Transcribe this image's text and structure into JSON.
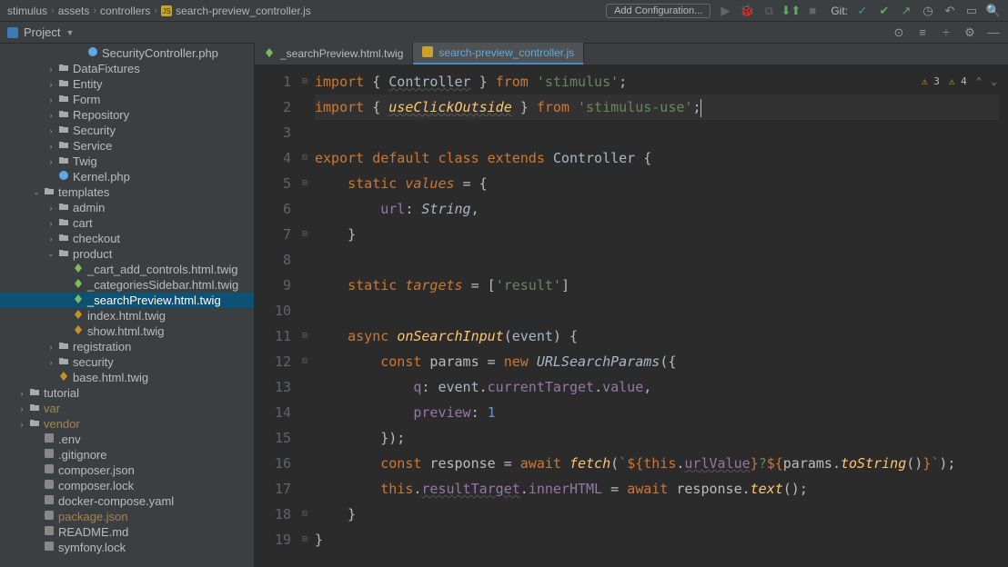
{
  "breadcrumb": [
    "stimulus",
    "assets",
    "controllers",
    "search-preview_controller.js"
  ],
  "toolbar": {
    "add_config": "Add Configuration...",
    "git_label": "Git:"
  },
  "project_header": "Project",
  "tree": [
    {
      "depth": 4,
      "chev": "",
      "icon": "php",
      "label": "SecurityController.php"
    },
    {
      "depth": 2,
      "chev": ">",
      "icon": "folder",
      "label": "DataFixtures"
    },
    {
      "depth": 2,
      "chev": ">",
      "icon": "folder",
      "label": "Entity"
    },
    {
      "depth": 2,
      "chev": ">",
      "icon": "folder",
      "label": "Form"
    },
    {
      "depth": 2,
      "chev": ">",
      "icon": "folder",
      "label": "Repository"
    },
    {
      "depth": 2,
      "chev": ">",
      "icon": "folder",
      "label": "Security"
    },
    {
      "depth": 2,
      "chev": ">",
      "icon": "folder",
      "label": "Service"
    },
    {
      "depth": 2,
      "chev": ">",
      "icon": "folder",
      "label": "Twig"
    },
    {
      "depth": 2,
      "chev": "",
      "icon": "php",
      "label": "Kernel.php"
    },
    {
      "depth": 1,
      "chev": "v",
      "icon": "folder",
      "label": "templates"
    },
    {
      "depth": 2,
      "chev": ">",
      "icon": "folder",
      "label": "admin"
    },
    {
      "depth": 2,
      "chev": ">",
      "icon": "folder",
      "label": "cart"
    },
    {
      "depth": 2,
      "chev": ">",
      "icon": "folder",
      "label": "checkout"
    },
    {
      "depth": 2,
      "chev": "v",
      "icon": "folder",
      "label": "product"
    },
    {
      "depth": 3,
      "chev": "",
      "icon": "twig",
      "label": "_cart_add_controls.html.twig"
    },
    {
      "depth": 3,
      "chev": "",
      "icon": "twig",
      "label": "_categoriesSidebar.html.twig"
    },
    {
      "depth": 3,
      "chev": "",
      "icon": "twig-sel",
      "label": "_searchPreview.html.twig",
      "selected": true
    },
    {
      "depth": 3,
      "chev": "",
      "icon": "twig-orange",
      "label": "index.html.twig"
    },
    {
      "depth": 3,
      "chev": "",
      "icon": "twig-orange",
      "label": "show.html.twig"
    },
    {
      "depth": 2,
      "chev": ">",
      "icon": "folder",
      "label": "registration"
    },
    {
      "depth": 2,
      "chev": ">",
      "icon": "folder",
      "label": "security"
    },
    {
      "depth": 2,
      "chev": "",
      "icon": "twig-orange",
      "label": "base.html.twig"
    },
    {
      "depth": 0,
      "chev": ">",
      "icon": "folder",
      "label": "tutorial"
    },
    {
      "depth": 0,
      "chev": ">",
      "icon": "folder",
      "label": "var",
      "dim": true
    },
    {
      "depth": 0,
      "chev": ">",
      "icon": "folder",
      "label": "vendor",
      "dim": true
    },
    {
      "depth": 1,
      "chev": "",
      "icon": "file",
      "label": ".env"
    },
    {
      "depth": 1,
      "chev": "",
      "icon": "file",
      "label": ".gitignore"
    },
    {
      "depth": 1,
      "chev": "",
      "icon": "json",
      "label": "composer.json"
    },
    {
      "depth": 1,
      "chev": "",
      "icon": "json",
      "label": "composer.lock"
    },
    {
      "depth": 1,
      "chev": "",
      "icon": "file",
      "label": "docker-compose.yaml"
    },
    {
      "depth": 1,
      "chev": "",
      "icon": "json",
      "label": "package.json",
      "dim": true
    },
    {
      "depth": 1,
      "chev": "",
      "icon": "file",
      "label": "README.md"
    },
    {
      "depth": 1,
      "chev": "",
      "icon": "file",
      "label": "symfony.lock"
    }
  ],
  "tabs": [
    {
      "label": "_searchPreview.html.twig",
      "active": false,
      "icon": "twig"
    },
    {
      "label": "search-preview_controller.js",
      "active": true,
      "icon": "js"
    }
  ],
  "editor": {
    "lines_count": 19,
    "warnings": {
      "a": "3",
      "b": "4"
    },
    "code_lines": [
      {
        "n": 1,
        "html": "<span class='kw'>import</span> { <span class='class ul-wave'>Controller</span> } <span class='kw'>from</span> <span class='str'>'stimulus'</span>;"
      },
      {
        "n": 2,
        "html": "<span class='kw'>import</span> { <span class='def ul-wave'>useClickOutside</span> } <span class='kw'>from</span> <span class='str'>'stimulus-use'</span>;<span class='caret'></span>",
        "hl": true
      },
      {
        "n": 3,
        "html": ""
      },
      {
        "n": 4,
        "html": "<span class='kw'>export default class extends</span> <span class='class'>Controller</span> {"
      },
      {
        "n": 5,
        "html": "    <span class='kw'>static</span> <span class='prop-it'>values</span> = {"
      },
      {
        "n": 6,
        "html": "        <span class='field'>url</span>: <span class='type-it'>String</span>,"
      },
      {
        "n": 7,
        "html": "    }"
      },
      {
        "n": 8,
        "html": ""
      },
      {
        "n": 9,
        "html": "    <span class='kw'>static</span> <span class='prop-it'>targets</span> = [<span class='str'>'result'</span>]"
      },
      {
        "n": 10,
        "html": ""
      },
      {
        "n": 11,
        "html": "    <span class='kw'>async</span> <span class='def'>onSearchInput</span>(<span class='param'>event</span>) {"
      },
      {
        "n": 12,
        "html": "        <span class='kw'>const</span> params = <span class='kw'>new</span> <span class='type-it'>URLSearchParams</span>({"
      },
      {
        "n": 13,
        "html": "            <span class='field'>q</span>: <span class='param'>event</span>.<span class='field'>currentTarget</span>.<span class='field'>value</span>,"
      },
      {
        "n": 14,
        "html": "            <span class='field'>preview</span>: <span class='num'>1</span>"
      },
      {
        "n": 15,
        "html": "        });"
      },
      {
        "n": 16,
        "html": "        <span class='kw'>const</span> response = <span class='kw'>await</span> <span class='def'>fetch</span>(<span class='str'>`</span><span class='kw'>${</span><span class='kw'>this</span>.<span class='field ul-wave'>urlValue</span><span class='kw'>}</span><span class='str'>?</span><span class='kw'>${</span>params.<span class='def'>toString</span>()<span class='kw'>}</span><span class='str'>`</span>);"
      },
      {
        "n": 17,
        "html": "        <span class='kw'>this</span>.<span class='field ul-wave'>resultTarget</span>.<span class='field'>innerHTML</span> = <span class='kw'>await</span> response.<span class='def'>text</span>();"
      },
      {
        "n": 18,
        "html": "    }"
      },
      {
        "n": 19,
        "html": "}"
      }
    ]
  }
}
